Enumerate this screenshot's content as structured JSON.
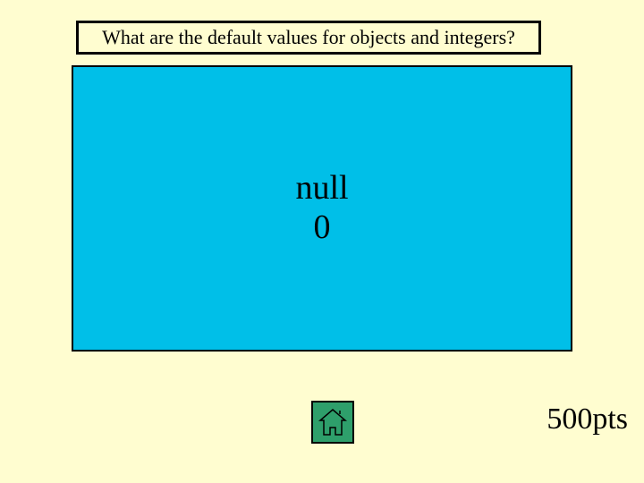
{
  "question": "What are the default values for objects and integers?",
  "answer": {
    "line1": "null",
    "line2": "0"
  },
  "points": "500pts"
}
